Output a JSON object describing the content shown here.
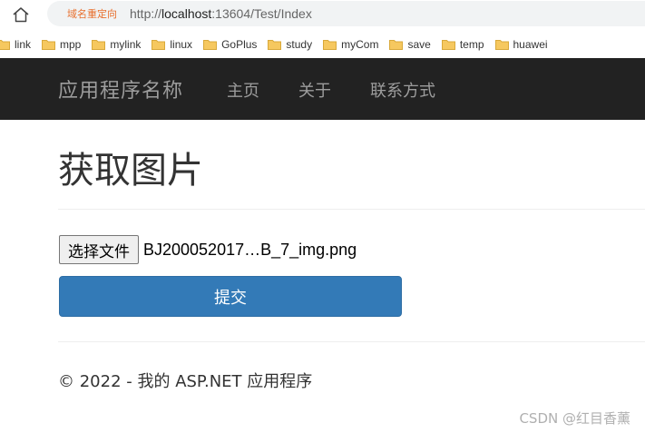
{
  "browser": {
    "redirect_tag": "域名重定向",
    "url_prefix": "http://",
    "url_host": "localhost",
    "url_rest": ":13604/Test/Index",
    "home_icon": "home-icon",
    "folder_icon": "folder-icon",
    "bookmarks": [
      "link",
      "mpp",
      "mylink",
      "linux",
      "GoPlus",
      "study",
      "myCom",
      "save",
      "temp",
      "huawei"
    ]
  },
  "navbar": {
    "brand": "应用程序名称",
    "links": [
      "主页",
      "关于",
      "联系方式"
    ]
  },
  "main": {
    "title": "获取图片",
    "file_button_label": "选择文件",
    "file_name": "BJ200052017…B_7_img.png",
    "submit_label": "提交"
  },
  "footer": {
    "text": "© 2022 - 我的 ASP.NET 应用程序"
  },
  "watermark": "CSDN @红目香薰",
  "colors": {
    "navbar_bg": "#222222",
    "nav_text": "#9d9d9d",
    "primary_button": "#337ab7",
    "redirect_tag": "#e86f2d"
  }
}
